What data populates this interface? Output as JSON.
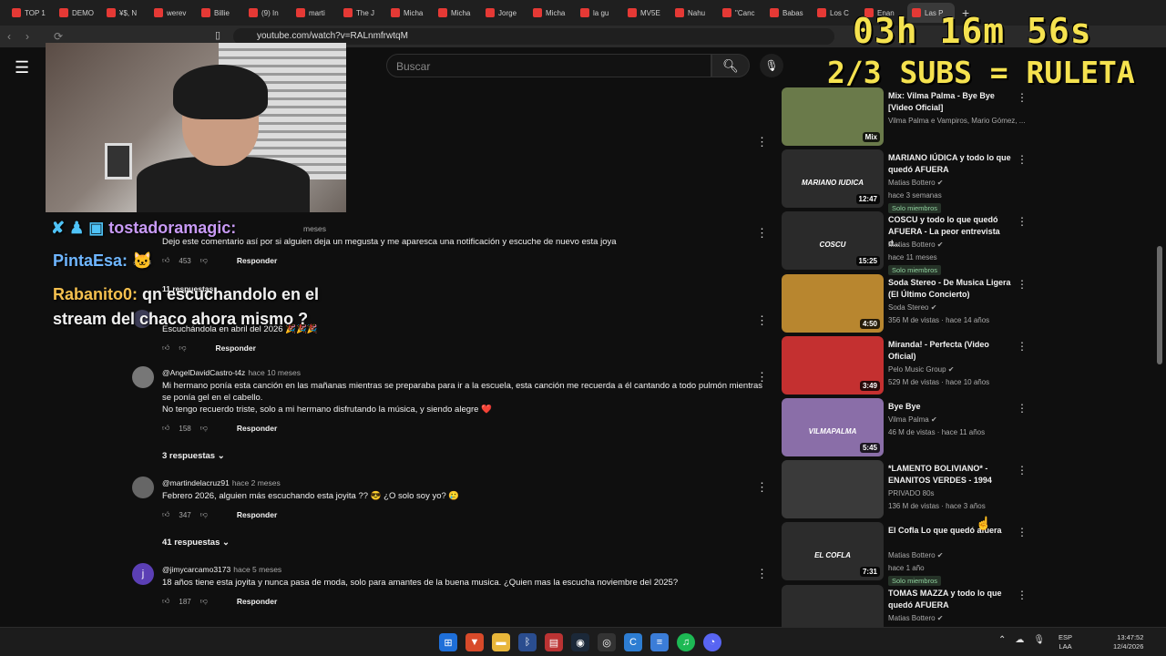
{
  "browser": {
    "tabs": [
      "TOP 1",
      "DEMO",
      "¥$, N",
      "werev",
      "Billie",
      "(9) In",
      "marti",
      "The J",
      "Micha",
      "Micha",
      "Jorge",
      "Micha",
      "la gu",
      "MV5E",
      "Nahu",
      "\"Canc",
      "Babas",
      "Los C",
      "Enan",
      "Las P"
    ],
    "new_tab_icon": "+",
    "url": "youtube.com/watch?v=RALnmfrwtqM"
  },
  "overlay": {
    "timer": "03h 16m 56s",
    "subs": "2/3 SUBS = RULETA",
    "chat": {
      "line1_user": "tostadoramagic:",
      "line2_user": "PintaEsa:",
      "line3_user": "Rabanito0:",
      "line3_text": " qn escuchandolo en el stream del chaco ahora mismo ?"
    }
  },
  "header": {
    "search_placeholder": "Buscar"
  },
  "comments": [
    {
      "author": "",
      "when": "meses",
      "text": "Dejo este comentario así por si alguien deja un megusta y me aparesca una notificación y escuche de nuevo esta joya",
      "likes": "453",
      "reply_label": "Responder",
      "replies": "11 respuestas"
    },
    {
      "author": "",
      "when": "",
      "text": "Escuchándola en abril del 2026 🎉🎉🎉",
      "likes": "",
      "reply_label": "Responder",
      "replies": ""
    },
    {
      "author": "@AngelDavidCastro-t4z",
      "when": "hace 10 meses",
      "text": "Mi hermano ponía esta canción en las mañanas mientras se preparaba para ir a la escuela, esta canción me recuerda a él cantando a todo pulmón mientras se ponía gel en el cabello.",
      "text2": "No tengo recuerdo triste, solo a mi hermano disfrutando la música, y siendo alegre ❤️",
      "likes": "158",
      "reply_label": "Responder",
      "replies": "3 respuestas"
    },
    {
      "author": "@martindelacruz91",
      "when": "hace 2 meses",
      "text": "Febrero 2026, alguien más escuchando esta joyita ?? 😎 ¿O solo soy yo? 🥲",
      "likes": "347",
      "reply_label": "Responder",
      "replies": "41 respuestas"
    },
    {
      "author": "@jimycarcamo3173",
      "when": "hace 5 meses",
      "avatar_letter": "j",
      "text": "18 años tiene esta joyita y nunca pasa de moda, solo para amantes de la buena musica. ¿Quien mas la escucha noviembre del 2025?",
      "likes": "187",
      "reply_label": "Responder",
      "replies": ""
    }
  ],
  "sidebar": [
    {
      "title": "Mix: Vilma Palma - Bye Bye [Video Oficial]",
      "channel": "Vilma Palma e Vampiros, Mario Gómez, ...",
      "meta": "",
      "duration": "Mix",
      "badge": "",
      "thumb_color": "#6a7a4a"
    },
    {
      "title": "MARIANO IÚDICA y todo lo que quedó AFUERA",
      "channel": "Matias Bottero ✔",
      "meta": "hace 3 semanas",
      "duration": "12:47",
      "badge": "Solo miembros",
      "thumb_color": "#2c2c2c",
      "thumb_text": "MARIANO IUDICA"
    },
    {
      "title": "COSCU y todo lo que quedó AFUERA - La peor entrevista d...",
      "channel": "Matias Bottero ✔",
      "meta": "hace 11 meses",
      "duration": "15:25",
      "badge": "Solo miembros",
      "thumb_color": "#2a2a2a",
      "thumb_text": "COSCU"
    },
    {
      "title": "Soda Stereo - De Musica Ligera (El Último Concierto)",
      "channel": "Soda Stereo ✔",
      "meta": "356 M de vistas · hace 14 años",
      "duration": "4:50",
      "badge": "",
      "thumb_color": "#b8862f"
    },
    {
      "title": "Miranda! - Perfecta (Video Oficial)",
      "channel": "Pelo Music Group ✔",
      "meta": "529 M de vistas · hace 10 años",
      "duration": "3:49",
      "badge": "",
      "thumb_color": "#c43030"
    },
    {
      "title": "Bye Bye",
      "channel": "Vilma Palma ✔",
      "meta": "46 M de vistas · hace 11 años",
      "duration": "5:45",
      "badge": "",
      "thumb_color": "#8a6ea8",
      "thumb_text": "VILMAPALMA"
    },
    {
      "title": "*LAMENTO BOLIVIANO* - ENANITOS VERDES - 1994",
      "channel": "PRIVADO 80s",
      "meta": "136 M de vistas · hace 3 años",
      "duration": "",
      "badge": "",
      "thumb_color": "#3a3a3a"
    },
    {
      "title": "El Cofla   Lo que quedó afuera",
      "channel": "Matias Bottero ✔",
      "meta": "hace 1 año",
      "duration": "7:31",
      "badge": "Solo miembros",
      "thumb_color": "#2c2c2c",
      "thumb_text": "EL COFLA"
    },
    {
      "title": "TOMAS MAZZA y todo lo que quedó AFUERA",
      "channel": "Matias Bottero ✔",
      "meta": "",
      "duration": "",
      "badge": "",
      "thumb_color": "#2c2c2c"
    }
  ],
  "taskbar": {
    "lang_top": "ESP",
    "lang_bottom": "LAA",
    "time": "13:47:52",
    "date": "12/4/2026"
  }
}
